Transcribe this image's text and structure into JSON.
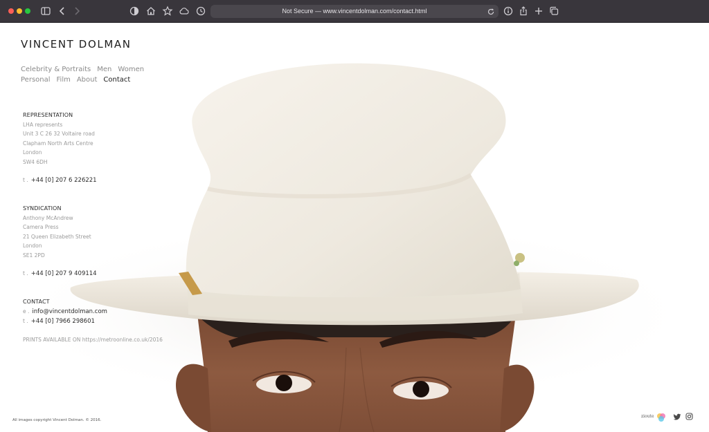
{
  "browser": {
    "url_text": "Not Secure — www.vincentdolman.com/contact.html",
    "icons": [
      "sidebar-icon",
      "back-icon",
      "forward-icon",
      "shield-icon",
      "home-icon",
      "star-icon",
      "cloud-icon",
      "history-icon",
      "reload-icon",
      "info-icon",
      "share-icon",
      "new-tab-icon",
      "tabs-icon"
    ]
  },
  "site": {
    "title": "VINCENT DOLMAN"
  },
  "nav": {
    "row1": [
      "Celebrity & Portraits",
      "Men",
      "Women"
    ],
    "row2": [
      "Personal",
      "Film",
      "About",
      "Contact"
    ],
    "active": "Contact"
  },
  "representation": {
    "heading": "REPRESENTATION",
    "lines": [
      "LHA represents",
      "Unit 3 C 26 32 Voltaire road",
      "Clapham North Arts Centre",
      "London",
      "SW4 6DH"
    ],
    "phone_prefix": "t .",
    "phone": "+44 [0] 207 6 226221"
  },
  "syndication": {
    "heading": "SYNDICATION",
    "lines": [
      "Anthony McAndrew",
      "Camera Press",
      "21 Queen Elizabeth Street",
      "London",
      "SE1 2PD"
    ],
    "phone_prefix": "t .",
    "phone": "+44 [0] 207 9 409114"
  },
  "contact": {
    "heading": "CONTACT",
    "email_prefix": "e .",
    "email": "info@vincentdolman.com",
    "phone_prefix": "t .",
    "phone": "+44 [0] 7966 298601"
  },
  "prints": {
    "text": "PRINTS AVAILABLE ON https://metroonline.co.uk/2016"
  },
  "footer": {
    "copyright": "All images copyright Vincent Dolman. © 2016.",
    "credit": "zioute",
    "social_icons": [
      "circles-logo-icon",
      "twitter-icon",
      "instagram-icon"
    ]
  },
  "colors": {
    "chrome": "#39363c",
    "urlbar": "#4a474d",
    "text_dark": "#1d1d1d",
    "text_light": "#9a9a9a"
  }
}
